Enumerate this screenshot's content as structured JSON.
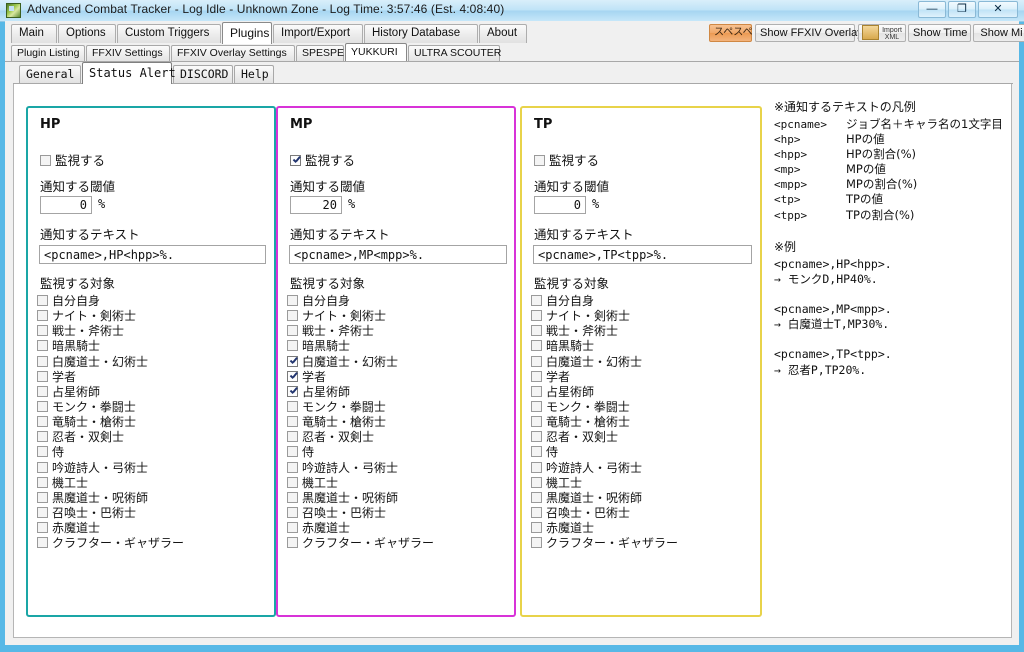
{
  "window": {
    "title": "Advanced Combat Tracker - Log Idle - Unknown Zone - Log Time: 3:57:46 (Est. 4:08:40)",
    "icon": "app-icon",
    "minimize": "—",
    "maximize": "❐",
    "close": "✕"
  },
  "main_tabs": [
    {
      "label": "Main",
      "active": false
    },
    {
      "label": "Options",
      "active": false
    },
    {
      "label": "Custom Triggers",
      "active": false
    },
    {
      "label": "Plugins",
      "active": true
    },
    {
      "label": "Import/Export",
      "active": false
    },
    {
      "label": "History Database",
      "active": false
    },
    {
      "label": "About",
      "active": false
    }
  ],
  "toolbar": [
    {
      "label": "スペスペ",
      "style": "orange"
    },
    {
      "label": "Show FFXIV Overlay",
      "style": "normal"
    },
    {
      "label": "Import XML",
      "style": "icon"
    },
    {
      "label": "Show Time",
      "style": "normal"
    },
    {
      "label": "Show Mi",
      "style": "normal"
    }
  ],
  "plugin_tabs": [
    {
      "label": "Plugin Listing",
      "active": false
    },
    {
      "label": "FFXIV Settings",
      "active": false
    },
    {
      "label": "FFXIV Overlay Settings",
      "active": false
    },
    {
      "label": "SPESPE",
      "active": false
    },
    {
      "label": "YUKKURI",
      "active": true
    },
    {
      "label": "ULTRA SCOUTER",
      "active": false
    }
  ],
  "sub_tabs": [
    {
      "label": "General",
      "active": false
    },
    {
      "label": "Status Alert",
      "active": true
    },
    {
      "label": "DISCORD",
      "active": false
    },
    {
      "label": "Help",
      "active": false
    }
  ],
  "labels": {
    "watch": "監視する",
    "threshold": "通知する閾値",
    "percent": "%",
    "notify_text": "通知するテキスト",
    "targets": "監視する対象"
  },
  "jobs": [
    "自分自身",
    "ナイト・剣術士",
    "戦士・斧術士",
    "暗黒騎士",
    "白魔道士・幻術士",
    "学者",
    "占星術師",
    "モンク・拳闘士",
    "竜騎士・槍術士",
    "忍者・双剣士",
    "侍",
    "吟遊詩人・弓術士",
    "機工士",
    "黒魔道士・呪術師",
    "召喚士・巴術士",
    "赤魔道士",
    "クラフター・ギャザラー"
  ],
  "panels": [
    {
      "id": "hp",
      "title": "HP",
      "border_color": "#1aa6a6",
      "watch_checked": false,
      "threshold": "0",
      "notify_text": "<pcname>,HP<hpp>%.",
      "job_checked": [
        false,
        false,
        false,
        false,
        false,
        false,
        false,
        false,
        false,
        false,
        false,
        false,
        false,
        false,
        false,
        false,
        false
      ]
    },
    {
      "id": "mp",
      "title": "MP",
      "border_color": "#d832d8",
      "watch_checked": true,
      "threshold": "20",
      "notify_text": "<pcname>,MP<mpp>%.",
      "job_checked": [
        false,
        false,
        false,
        false,
        true,
        true,
        true,
        false,
        false,
        false,
        false,
        false,
        false,
        false,
        false,
        false,
        false
      ]
    },
    {
      "id": "tp",
      "title": "TP",
      "border_color": "#e8d34a",
      "watch_checked": false,
      "threshold": "0",
      "notify_text": "<pcname>,TP<tpp>%.",
      "job_checked": [
        false,
        false,
        false,
        false,
        false,
        false,
        false,
        false,
        false,
        false,
        false,
        false,
        false,
        false,
        false,
        false,
        false
      ]
    }
  ],
  "legend": {
    "heading": "※通知するテキストの凡例",
    "rows": [
      {
        "key": "<pcname>",
        "value": "ジョブ名＋キャラ名の1文字目"
      },
      {
        "key": "<hp>",
        "value": "HPの値"
      },
      {
        "key": "<hpp>",
        "value": "HPの割合(%)"
      },
      {
        "key": "<mp>",
        "value": "MPの値"
      },
      {
        "key": "<mpp>",
        "value": "MPの割合(%)"
      },
      {
        "key": "<tp>",
        "value": "TPの値"
      },
      {
        "key": "<tpp>",
        "value": "TPの割合(%)"
      }
    ],
    "examples_heading": "※例",
    "examples": [
      {
        "pattern": "<pcname>,HP<hpp>.",
        "result": "→ モンクD,HP40%."
      },
      {
        "pattern": "<pcname>,MP<mpp>.",
        "result": "→ 白魔道士T,MP30%."
      },
      {
        "pattern": "<pcname>,TP<tpp>.",
        "result": "→ 忍者P,TP20%."
      }
    ]
  }
}
